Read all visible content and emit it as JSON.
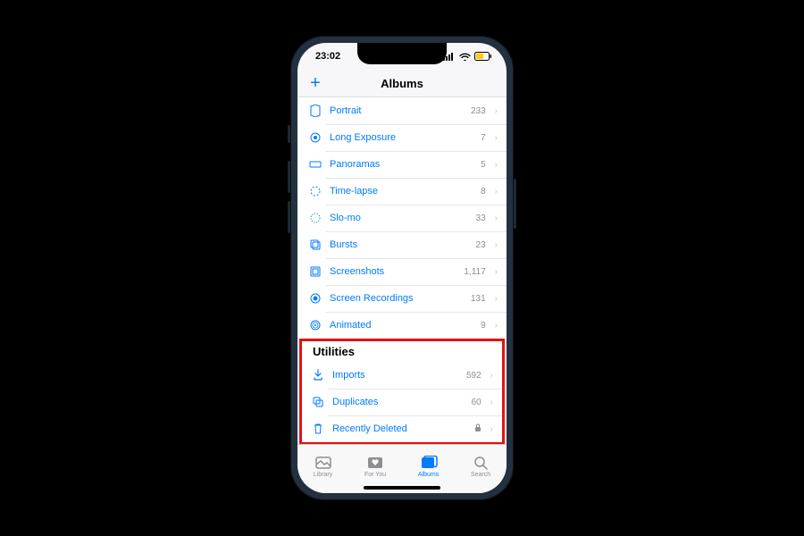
{
  "status": {
    "time": "23:02"
  },
  "header": {
    "title": "Albums",
    "add_label": "+"
  },
  "media_types": [
    {
      "icon": "portrait",
      "label": "Portrait",
      "count": "233"
    },
    {
      "icon": "long-exposure",
      "label": "Long Exposure",
      "count": "7"
    },
    {
      "icon": "panorama",
      "label": "Panoramas",
      "count": "5"
    },
    {
      "icon": "time-lapse",
      "label": "Time-lapse",
      "count": "8"
    },
    {
      "icon": "slo-mo",
      "label": "Slo-mo",
      "count": "33"
    },
    {
      "icon": "bursts",
      "label": "Bursts",
      "count": "23"
    },
    {
      "icon": "screenshots",
      "label": "Screenshots",
      "count": "1,117"
    },
    {
      "icon": "screen-recordings",
      "label": "Screen Recordings",
      "count": "131"
    },
    {
      "icon": "animated",
      "label": "Animated",
      "count": "9"
    }
  ],
  "utilities": {
    "title": "Utilities",
    "items": [
      {
        "icon": "imports",
        "label": "Imports",
        "count": "592"
      },
      {
        "icon": "duplicates",
        "label": "Duplicates",
        "count": "60"
      },
      {
        "icon": "trash",
        "label": "Recently Deleted",
        "locked": true
      }
    ]
  },
  "tabs": {
    "library": "Library",
    "for_you": "For You",
    "albums": "Albums",
    "search": "Search",
    "active": "albums"
  }
}
